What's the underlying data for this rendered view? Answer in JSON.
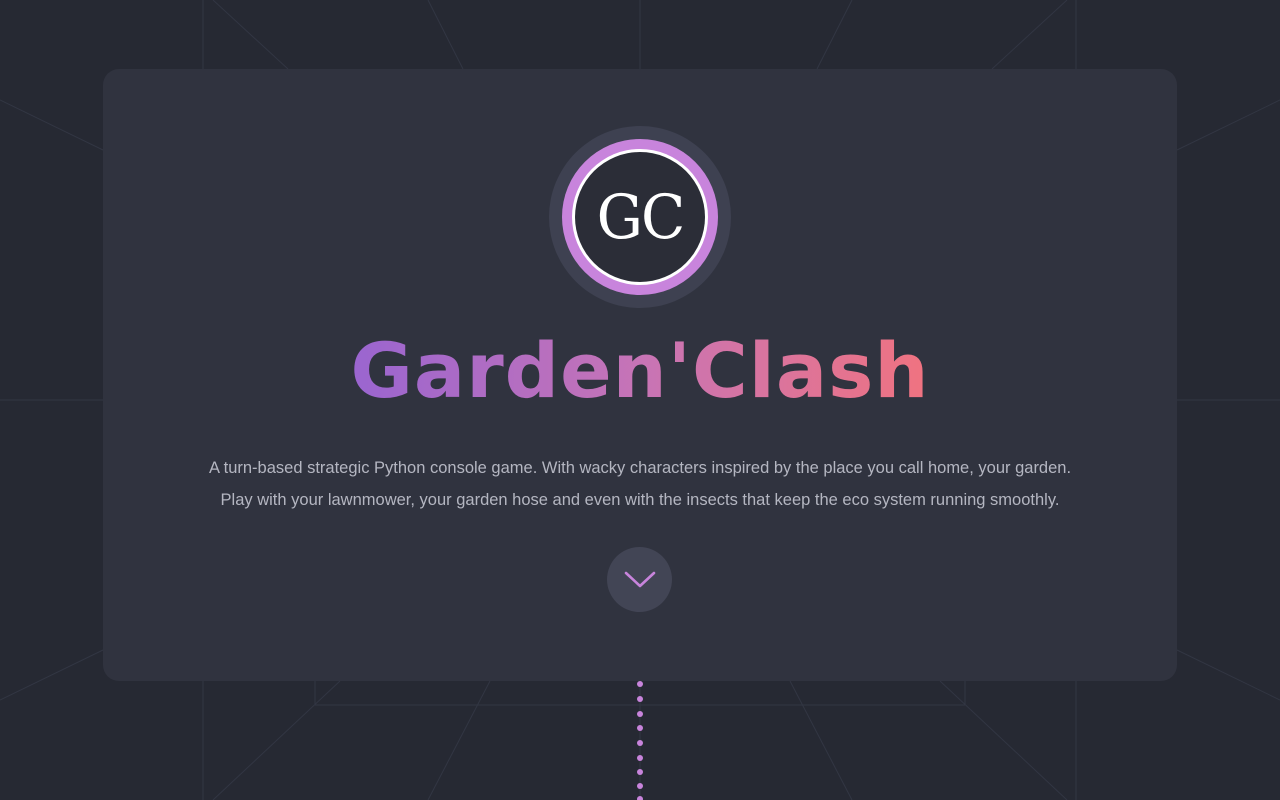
{
  "logo": {
    "text": "GC"
  },
  "hero": {
    "title": "Garden'Clash",
    "description_line1": "A turn-based strategic Python console game. With wacky characters inspired by the place you call home, your garden.",
    "description_line2": "Play with your lawnmower, your garden hose and even with the insects that keep the eco system running smoothly."
  },
  "scroll_button": {
    "icon": "chevron-down-icon"
  },
  "colors": {
    "background": "#262933",
    "card": "#30333f",
    "accent": "#c884dc",
    "title_gradient_start": "#9a65d0",
    "title_gradient_end": "#f07380",
    "description_text": "#b4b6c1"
  }
}
